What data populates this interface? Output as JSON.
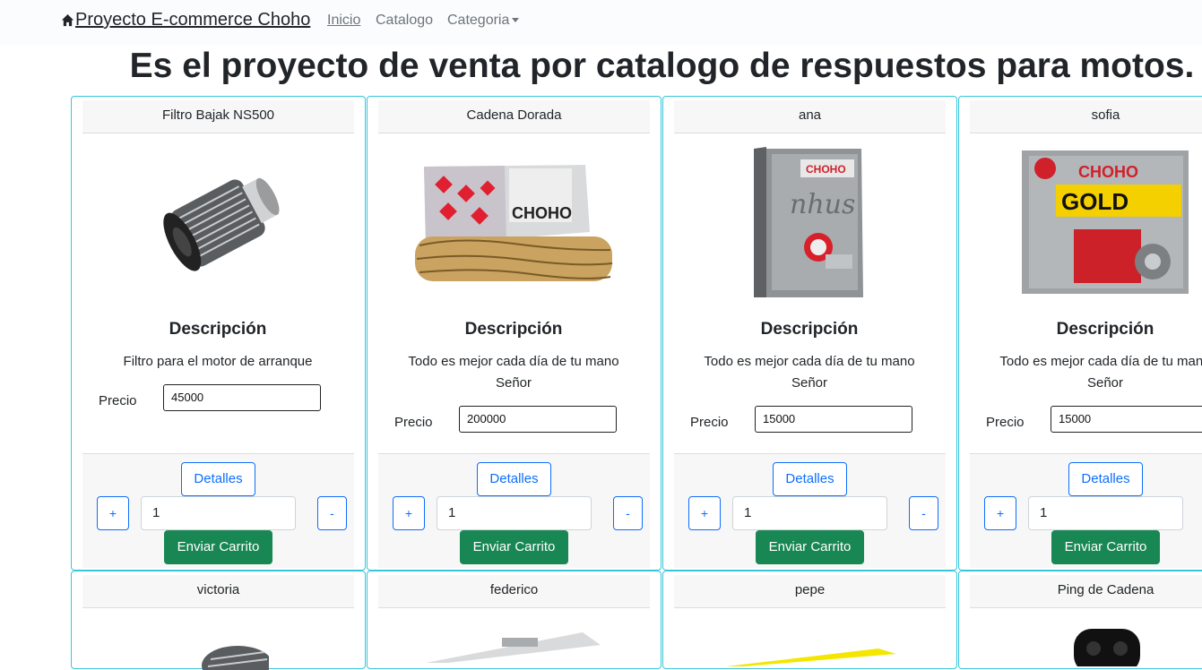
{
  "navbar": {
    "brand": "Proyecto E-commerce Choho",
    "links": [
      "Inicio",
      "Catalogo",
      "Categoria"
    ]
  },
  "hero_title": "Es el proyecto de venta por catalogo de respuestos para motos.",
  "card_labels": {
    "description_title": "Descripción",
    "price_label": "Precio",
    "details_button": "Detalles",
    "plus_button": "+",
    "minus_button": "-",
    "cart_button": "Enviar Carrito"
  },
  "products": [
    {
      "name": "Filtro Bajak NS500",
      "description": "Filtro para el motor de arranque",
      "price": "45000",
      "quantity": "1",
      "image": "air-filter-image"
    },
    {
      "name": "Cadena Dorada",
      "description": "Todo es mejor cada día de tu mano Señor",
      "price": "200000",
      "quantity": "1",
      "image": "gold-chain-box-image"
    },
    {
      "name": "ana",
      "description": "Todo es mejor cada día de tu mano Señor",
      "price": "15000",
      "quantity": "1",
      "image": "choho-silver-box-image"
    },
    {
      "name": "sofia",
      "description": "Todo es mejor cada día de tu mano Señor",
      "price": "15000",
      "quantity": "1",
      "image": "choho-gold-box-image"
    }
  ],
  "products_row2": [
    {
      "name": "victoria",
      "image": "air-filter-image"
    },
    {
      "name": "federico",
      "image": "chain-box-image"
    },
    {
      "name": "pepe",
      "image": "yellow-box-image"
    },
    {
      "name": "Ping de Cadena",
      "image": "chain-link-image"
    }
  ],
  "colors": {
    "card_border": "#35c6dd",
    "primary": "#0d6efd",
    "success": "#198754"
  }
}
